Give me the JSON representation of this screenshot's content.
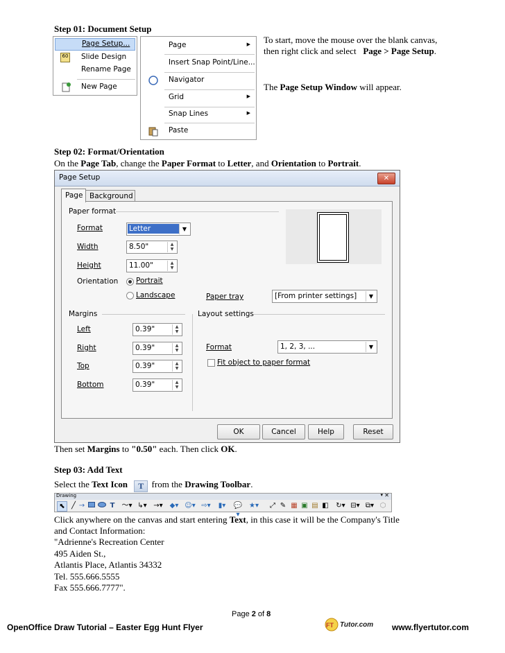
{
  "step1": {
    "heading": "Step 01: Document Setup",
    "menu1": {
      "items": [
        "Page Setup...",
        "Slide Design",
        "Rename Page",
        "New Page"
      ]
    },
    "menu2": {
      "items": [
        "Page",
        "Insert Snap Point/Line...",
        "Navigator",
        "Grid",
        "Snap Lines",
        "Paste"
      ]
    },
    "desc_a": "To start, move the mouse over the blank canvas, then right click and select",
    "desc_b": "Page > Page Setup",
    "desc_c": ".",
    "desc2_a": "The ",
    "desc2_b": "Page Setup Window",
    "desc2_c": " will appear."
  },
  "step2": {
    "heading": "Step 02: Format/Orientation",
    "t1": "On the ",
    "t2": "Page Tab",
    "t3": ", change the ",
    "t4": "Paper Format",
    "t5": " to ",
    "t6": "Letter",
    "t7": ", and ",
    "t8": "Orientation",
    "t9": " to ",
    "t10": "Portrait",
    "t11": "."
  },
  "dialog": {
    "title": "Page Setup",
    "close": "✕",
    "tabs": [
      "Page",
      "Background"
    ],
    "paper_format_group": "Paper format",
    "format_label": "Format",
    "format_value": "Letter",
    "width_label": "Width",
    "width_value": "8.50\"",
    "height_label": "Height",
    "height_value": "11.00\"",
    "orientation_label": "Orientation",
    "portrait": "Portrait",
    "landscape": "Landscape",
    "paper_tray_label": "Paper tray",
    "paper_tray_value": "[From printer settings]",
    "margins_group": "Margins",
    "left_label": "Left",
    "left_value": "0.39\"",
    "right_label": "Right",
    "right_value": "0.39\"",
    "top_label": "Top",
    "top_value": "0.39\"",
    "bottom_label": "Bottom",
    "bottom_value": "0.39\"",
    "layout_group": "Layout settings",
    "layout_format_label": "Format",
    "layout_format_value": "1, 2, 3, ...",
    "fit_label": "Fit object to paper format",
    "buttons": {
      "ok": "OK",
      "cancel": "Cancel",
      "help": "Help",
      "reset": "Reset"
    }
  },
  "after_dialog": {
    "a": "Then set ",
    "b": "Margins",
    "c": " to ",
    "d": "\"0.50\"",
    "e": " each. Then click ",
    "f": "OK",
    "g": "."
  },
  "step3": {
    "heading": "Step 03: Add Text",
    "s1": "Select the ",
    "s2": "Text Icon",
    "s3": " from the ",
    "s4": "Drawing Toolbar",
    "s5": ".",
    "toolbar_title": "Drawing",
    "c1": "Click anywhere on the canvas and start entering ",
    "c2": "Text",
    "c3": ", in this case it will be the Company's Title",
    "c4": "and Contact Information:",
    "lines": [
      "\"Adrienne's Recreation Center",
      "495 Aiden St.,",
      "Atlantis Place, Atlantis 34332",
      "Tel. 555.666.5555",
      "Fax 555.666.7777\"."
    ]
  },
  "footer": {
    "page_prefix": "Page ",
    "page_num": "2",
    "page_of": " of ",
    "page_total": "8",
    "left": "OpenOffice Draw Tutorial – Easter Egg Hunt Flyer",
    "logo_text": "Tutor.com",
    "right": "www.flyertutor.com"
  }
}
